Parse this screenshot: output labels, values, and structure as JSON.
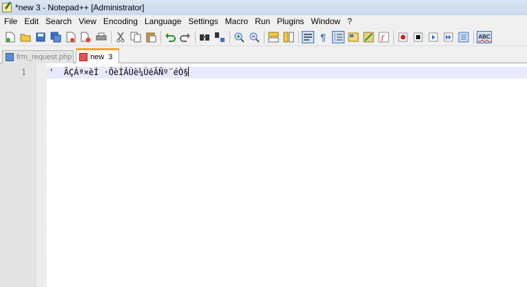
{
  "window": {
    "title": "*new  3 - Notepad++ [Administrator]"
  },
  "menu": [
    "File",
    "Edit",
    "Search",
    "View",
    "Encoding",
    "Language",
    "Settings",
    "Macro",
    "Run",
    "Plugins",
    "Window",
    "?"
  ],
  "toolbar": {
    "groups": [
      [
        "new-file-icon",
        "open-file-icon",
        "save-icon",
        "save-all-icon",
        "close-icon",
        "close-all-icon",
        "print-icon"
      ],
      [
        "cut-icon",
        "copy-icon",
        "paste-icon"
      ],
      [
        "undo-icon",
        "redo-icon"
      ],
      [
        "find-icon",
        "replace-icon"
      ],
      [
        "zoom-in-icon",
        "zoom-out-icon"
      ],
      [
        "sync-vertical-icon",
        "sync-horizontal-icon"
      ],
      [
        "word-wrap-icon",
        "show-all-chars-icon",
        "indent-guide-icon",
        "user-language-icon",
        "document-map-icon",
        "function-list-icon"
      ],
      [
        "record-macro-icon",
        "stop-macro-icon",
        "play-macro-icon",
        "run-macro-multiple-icon",
        "save-macro-icon"
      ],
      [
        "spellcheck-icon"
      ]
    ],
    "spellcheck_label": "ABC"
  },
  "tabs": [
    {
      "label": "frm_request.php",
      "active": false,
      "state": "saved"
    },
    {
      "label": "new  3",
      "active": true,
      "state": "dirty"
    }
  ],
  "editor": {
    "line_number": "1",
    "content": "'  ÃÇÁª×èÍ ·ÕèÍÂÙè¼ÙéÃÑº¨éÒ§"
  }
}
